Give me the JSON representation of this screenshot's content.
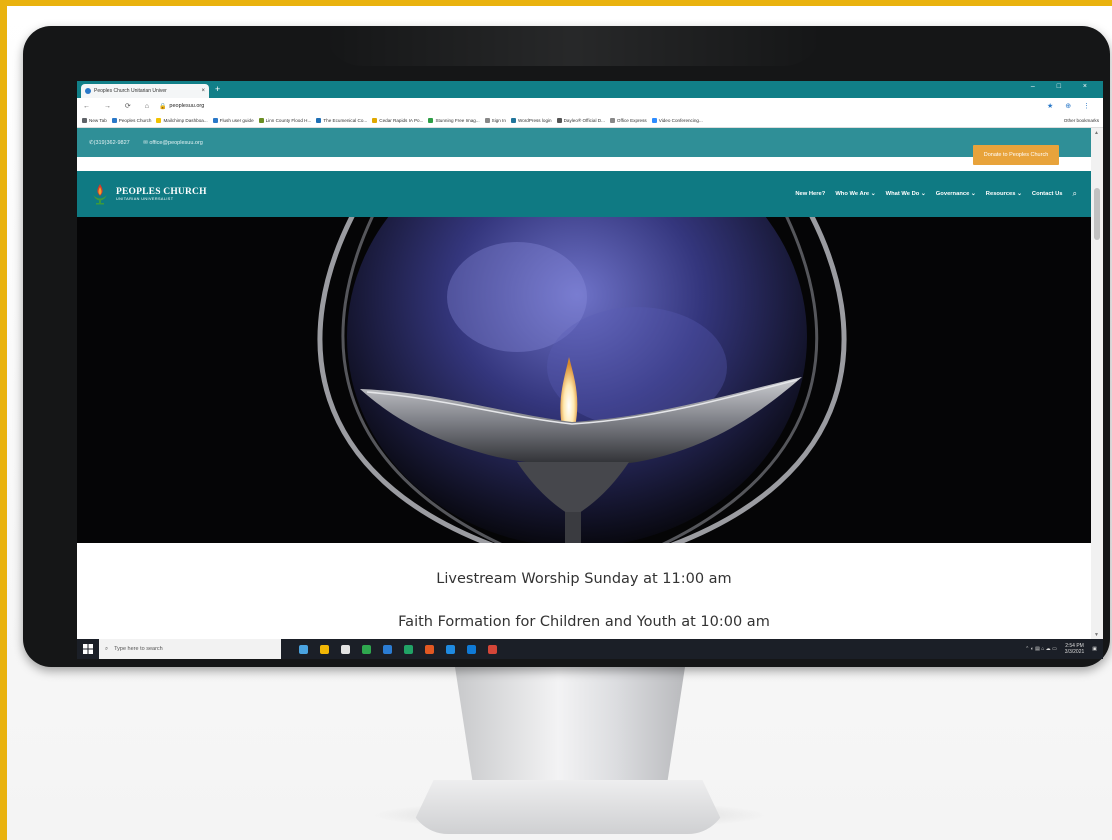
{
  "browser": {
    "tab_title": "Peoples Church Unitarian Univer",
    "tab_close": "×",
    "new_tab": "+",
    "window_controls": "–  □  ×",
    "nav_buttons": "← → ⟳ ⌂",
    "url": "peoplesuu.org",
    "right_icons": "★ ⊕ ⋮",
    "bookmarks": [
      {
        "label": "New Tab",
        "color": "#5f6368"
      },
      {
        "label": "Peoples Church",
        "color": "#2a78c8"
      },
      {
        "label": "Mailchimp Dashboa...",
        "color": "#f2c200"
      },
      {
        "label": "Flush user guide",
        "color": "#2a78c8"
      },
      {
        "label": "Linn County Flood H...",
        "color": "#6b8e23"
      },
      {
        "label": "The Ecumenical Co...",
        "color": "#1f6fb5"
      },
      {
        "label": "Cedar Rapids IA Po...",
        "color": "#e0a800"
      },
      {
        "label": "Stunning Free Imag...",
        "color": "#2e9e46"
      },
      {
        "label": "Sign In",
        "color": "#888888"
      },
      {
        "label": "WordPress login",
        "color": "#21759b"
      },
      {
        "label": "Dayleo® Official D...",
        "color": "#555555"
      },
      {
        "label": "Office Express",
        "color": "#888888"
      },
      {
        "label": "Video Conferencing...",
        "color": "#2d8cff"
      }
    ],
    "other_bookmarks": "Other bookmarks"
  },
  "site": {
    "phone": "(319)362-9827",
    "email": "office@peoplesuu.org",
    "donate_label": "Donate to Peoples Church",
    "logo_name": "PEOPLES CHURCH",
    "logo_sub": "UNITARIAN UNIVERSALIST",
    "menu": [
      "New Here?",
      "Who We Are ⌄",
      "What We Do ⌄",
      "Governance ⌄",
      "Resources ⌄",
      "Contact Us"
    ],
    "search_icon": "⌕",
    "headline_1": "Livestream Worship Sunday at 11:00 am",
    "headline_2": "Faith Formation for Children and Youth at 10:00 am"
  },
  "taskbar": {
    "search_placeholder": "Type here to search",
    "time": "2:54 PM",
    "date": "3/3/2021",
    "icons": [
      "#4aa3e0",
      "#f2b705",
      "#e2e2e2",
      "#2fa84f",
      "#2b7cd3",
      "#21a366",
      "#e25822",
      "#1f8ae0",
      "#0f7ad6",
      "#d44638"
    ]
  },
  "colors": {
    "frame": "#e9b20e",
    "tab_bar": "#117f88",
    "site_nav": "#0f7a83",
    "site_top": "#2f8f97",
    "donate": "#e8a33b"
  }
}
